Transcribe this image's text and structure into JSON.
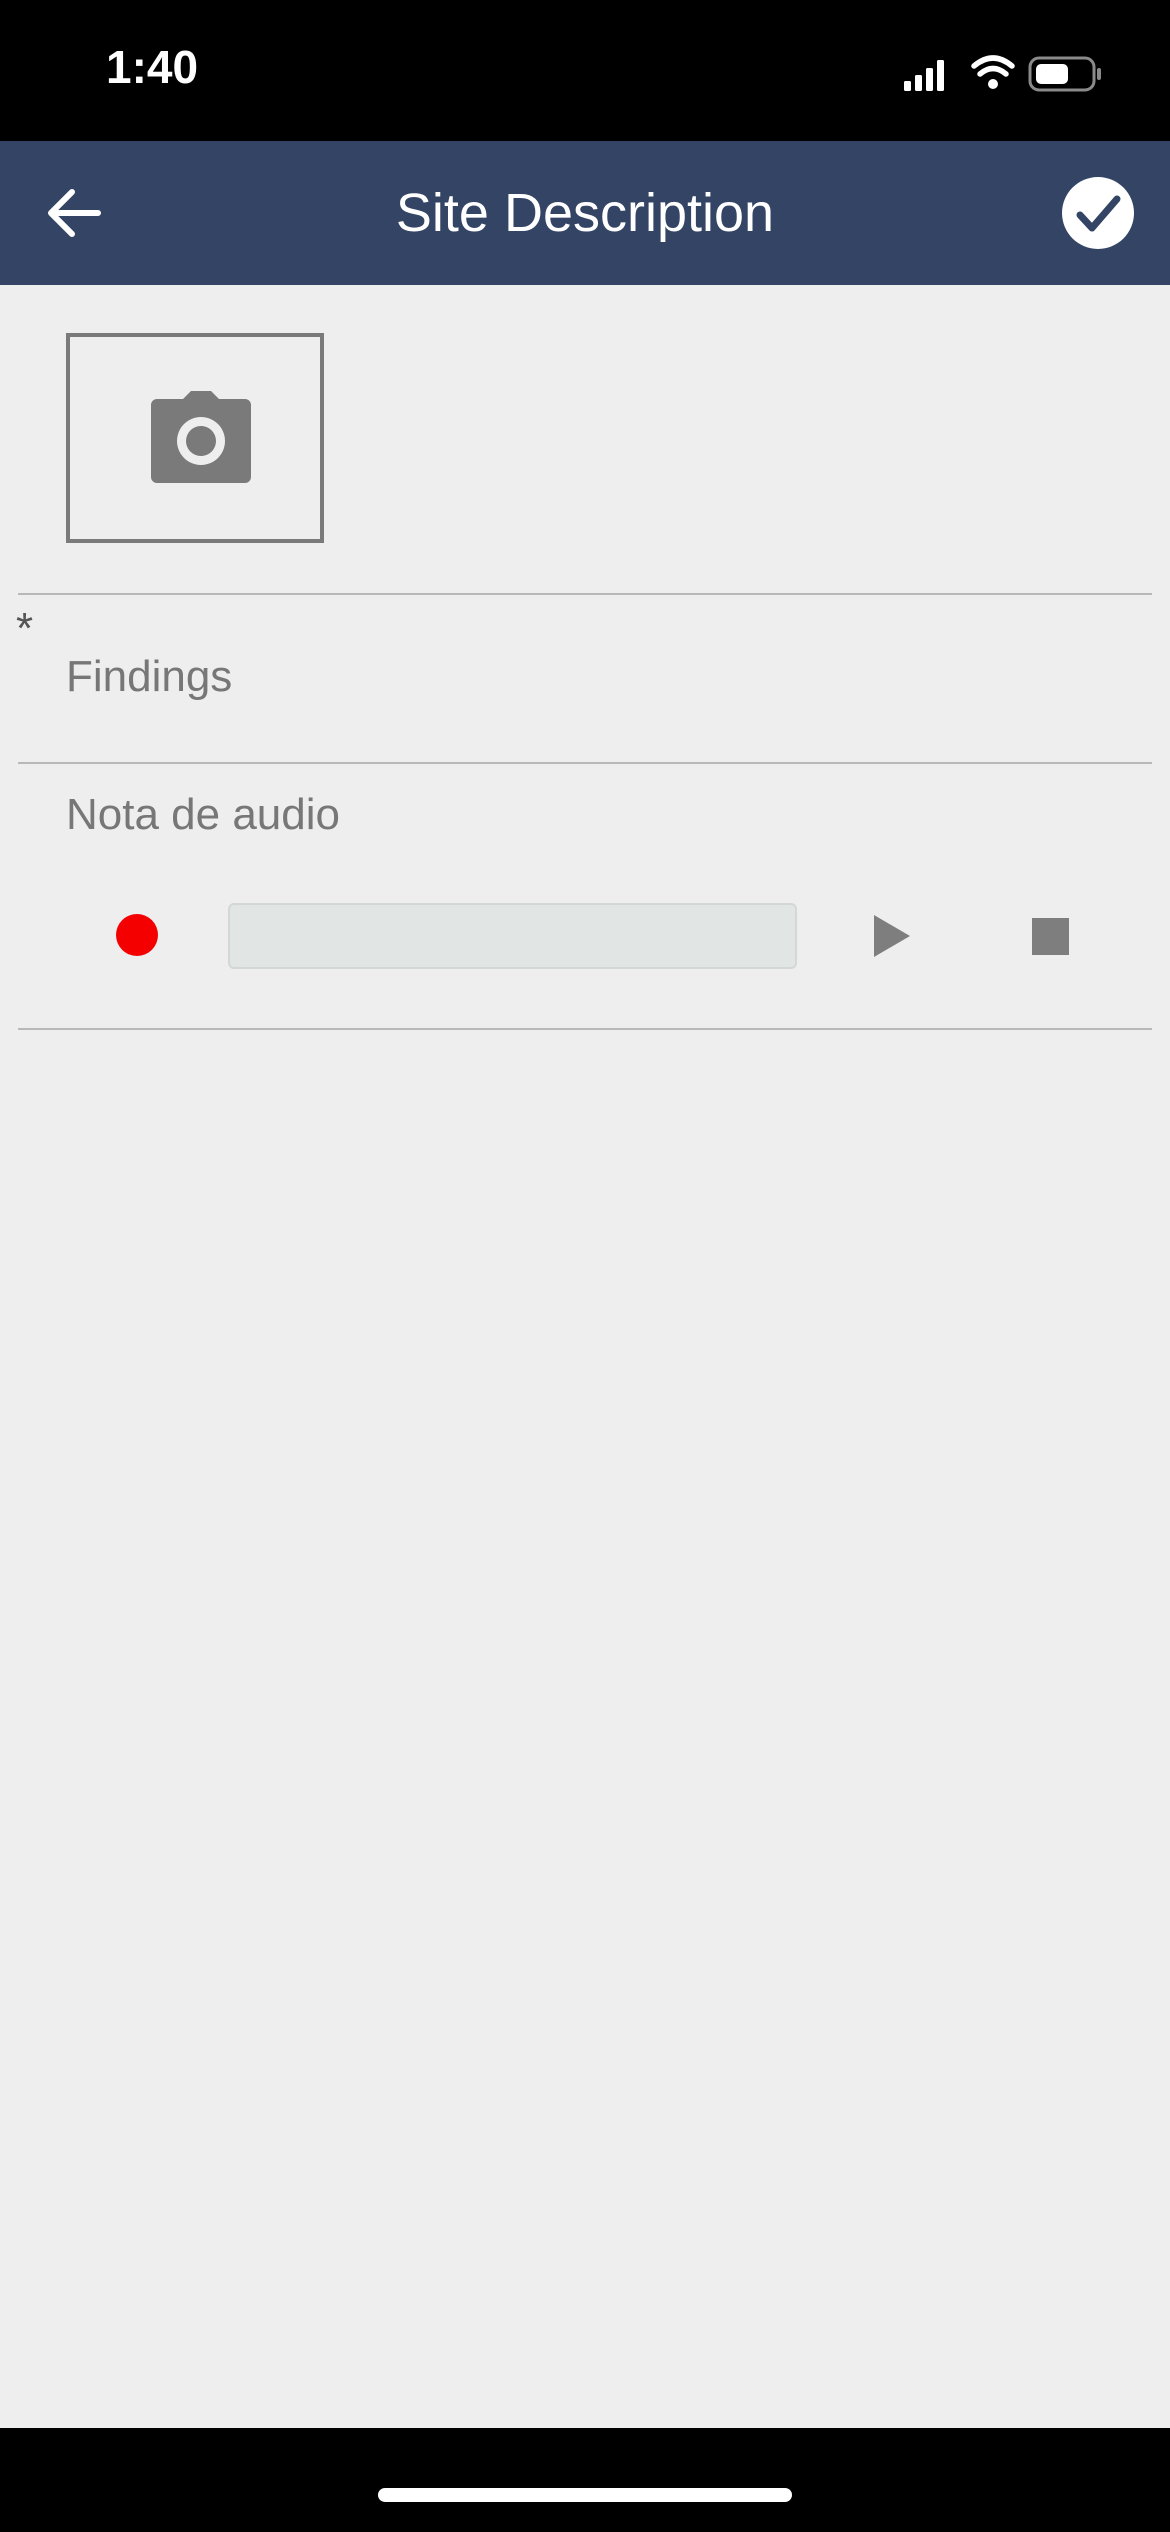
{
  "status_bar": {
    "time": "1:40"
  },
  "nav": {
    "title": "Site Description",
    "back_icon": "arrow-left-icon",
    "done_icon": "check-circle-icon"
  },
  "photo": {
    "icon": "camera-icon"
  },
  "findings": {
    "required_marker": "*",
    "label": "Findings"
  },
  "audio": {
    "label": "Nota de audio",
    "record_icon": "record-icon",
    "play_icon": "play-icon",
    "stop_icon": "stop-icon",
    "record_color": "#f40000"
  },
  "colors": {
    "nav_background": "#334465",
    "page_background": "#eeeeee"
  }
}
